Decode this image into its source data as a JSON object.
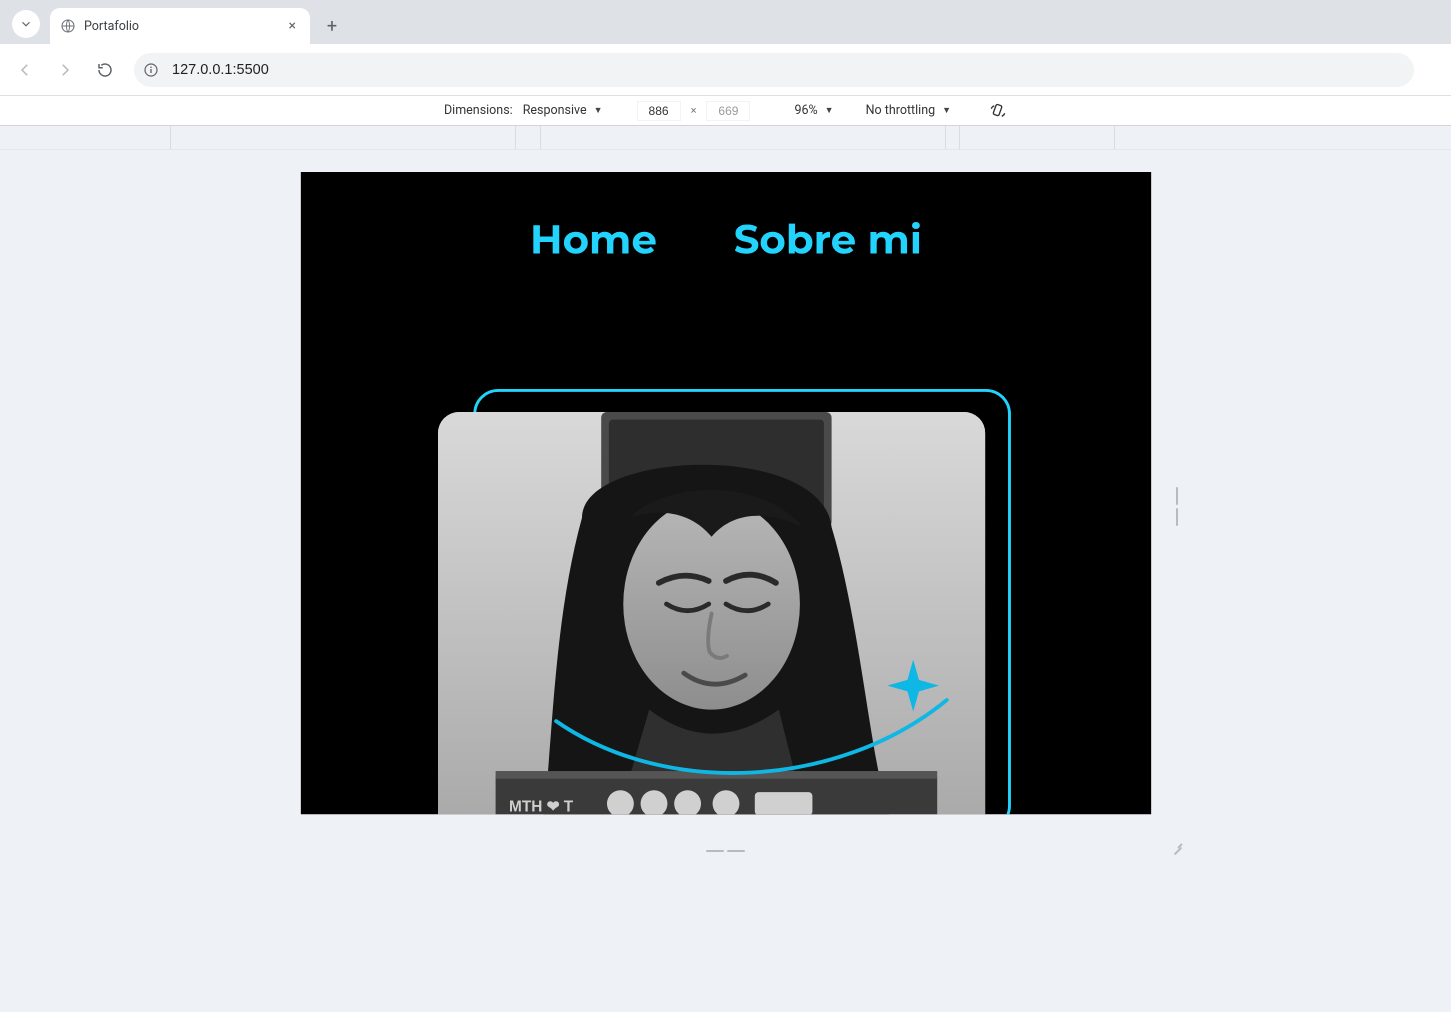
{
  "browser": {
    "tab_title": "Portafolio",
    "url": "127.0.0.1:5500",
    "new_tab_tooltip": "+",
    "close_tab": "×"
  },
  "devtools": {
    "dimensions_label": "Dimensions:",
    "dimensions_mode": "Responsive",
    "width": "886",
    "height": "669",
    "separator": "×",
    "zoom": "96%",
    "throttling": "No throttling"
  },
  "page": {
    "nav": {
      "home": "Home",
      "about": "Sobre mi"
    },
    "accent_color": "#22D4FD"
  }
}
